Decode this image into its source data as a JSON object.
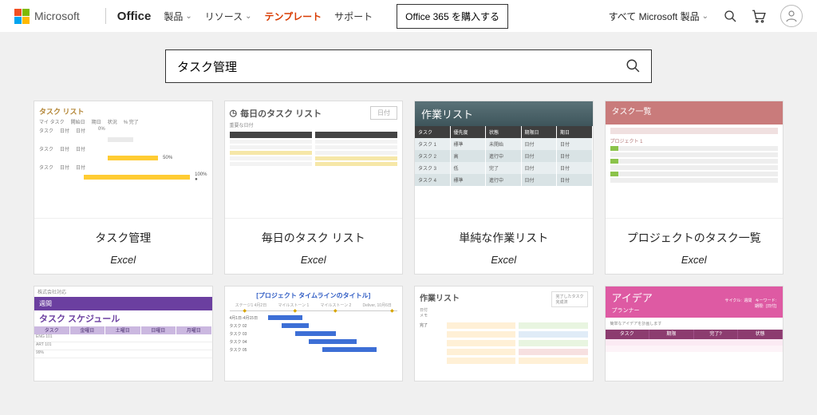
{
  "header": {
    "microsoft": "Microsoft",
    "office": "Office",
    "nav": {
      "products": "製品",
      "resources": "リソース",
      "templates": "テンプレート",
      "support": "サポート"
    },
    "buy_button": "Office 365 を購入する",
    "all_products": "すべて Microsoft 製品"
  },
  "search": {
    "value": "タスク管理",
    "placeholder": ""
  },
  "cards": [
    {
      "title": "タスク管理",
      "app": "Excel",
      "thumb_label": "タスク リスト"
    },
    {
      "title": "毎日のタスク リスト",
      "app": "Excel",
      "thumb_label": "毎日のタスク リスト",
      "thumb_badge": "日付"
    },
    {
      "title": "単純な作業リスト",
      "app": "Excel",
      "thumb_label": "作業リスト"
    },
    {
      "title": "プロジェクトのタスク一覧",
      "app": "Excel",
      "thumb_label": "タスク一覧"
    }
  ],
  "row2": [
    {
      "thumb_top": "週間",
      "thumb_label": "タスク スケジュール"
    },
    {
      "thumb_label": "[プロジェクト タイムラインのタイトル]"
    },
    {
      "thumb_label": "作業リスト"
    },
    {
      "thumb_label": "アイデア",
      "thumb_sub": "プランナー"
    }
  ],
  "table_headers": {
    "t1": [
      "マイ タスク",
      "開始日",
      "期日",
      "状況",
      "% 完了"
    ],
    "t3": [
      "タスク",
      "優先度",
      "状態",
      "期限日",
      "期日"
    ],
    "t5": [
      "タスク",
      "金曜日",
      "土曜日",
      "日曜日",
      "月曜日"
    ],
    "t8": [
      "タスク",
      "期限",
      "完了?",
      "状態"
    ]
  }
}
